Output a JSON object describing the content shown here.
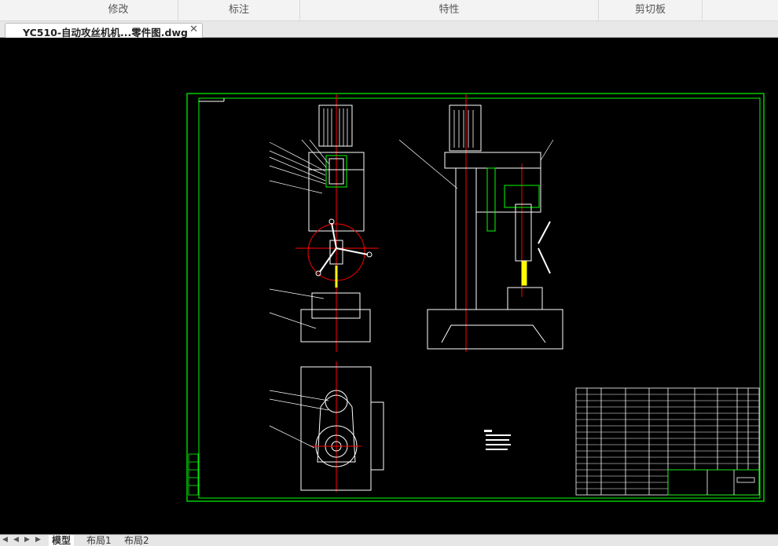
{
  "ribbon": {
    "panels": [
      "修改",
      "标注",
      "特性",
      "剪切板"
    ]
  },
  "document_tab": {
    "title": "YC510-自动攻丝机机...零件图.dwg",
    "close_glyph": "✕"
  },
  "layout_tabs": {
    "nav_glyphs": [
      "◀",
      "◀",
      "▶",
      "▶"
    ],
    "tabs": [
      "模型",
      "布局1",
      "布局2"
    ],
    "active": "模型"
  },
  "colors": {
    "frame": "#00ff00",
    "outline": "#ffffff",
    "centerline": "#ff0000",
    "highlight": "#ffff00",
    "canvas": "#000000"
  }
}
